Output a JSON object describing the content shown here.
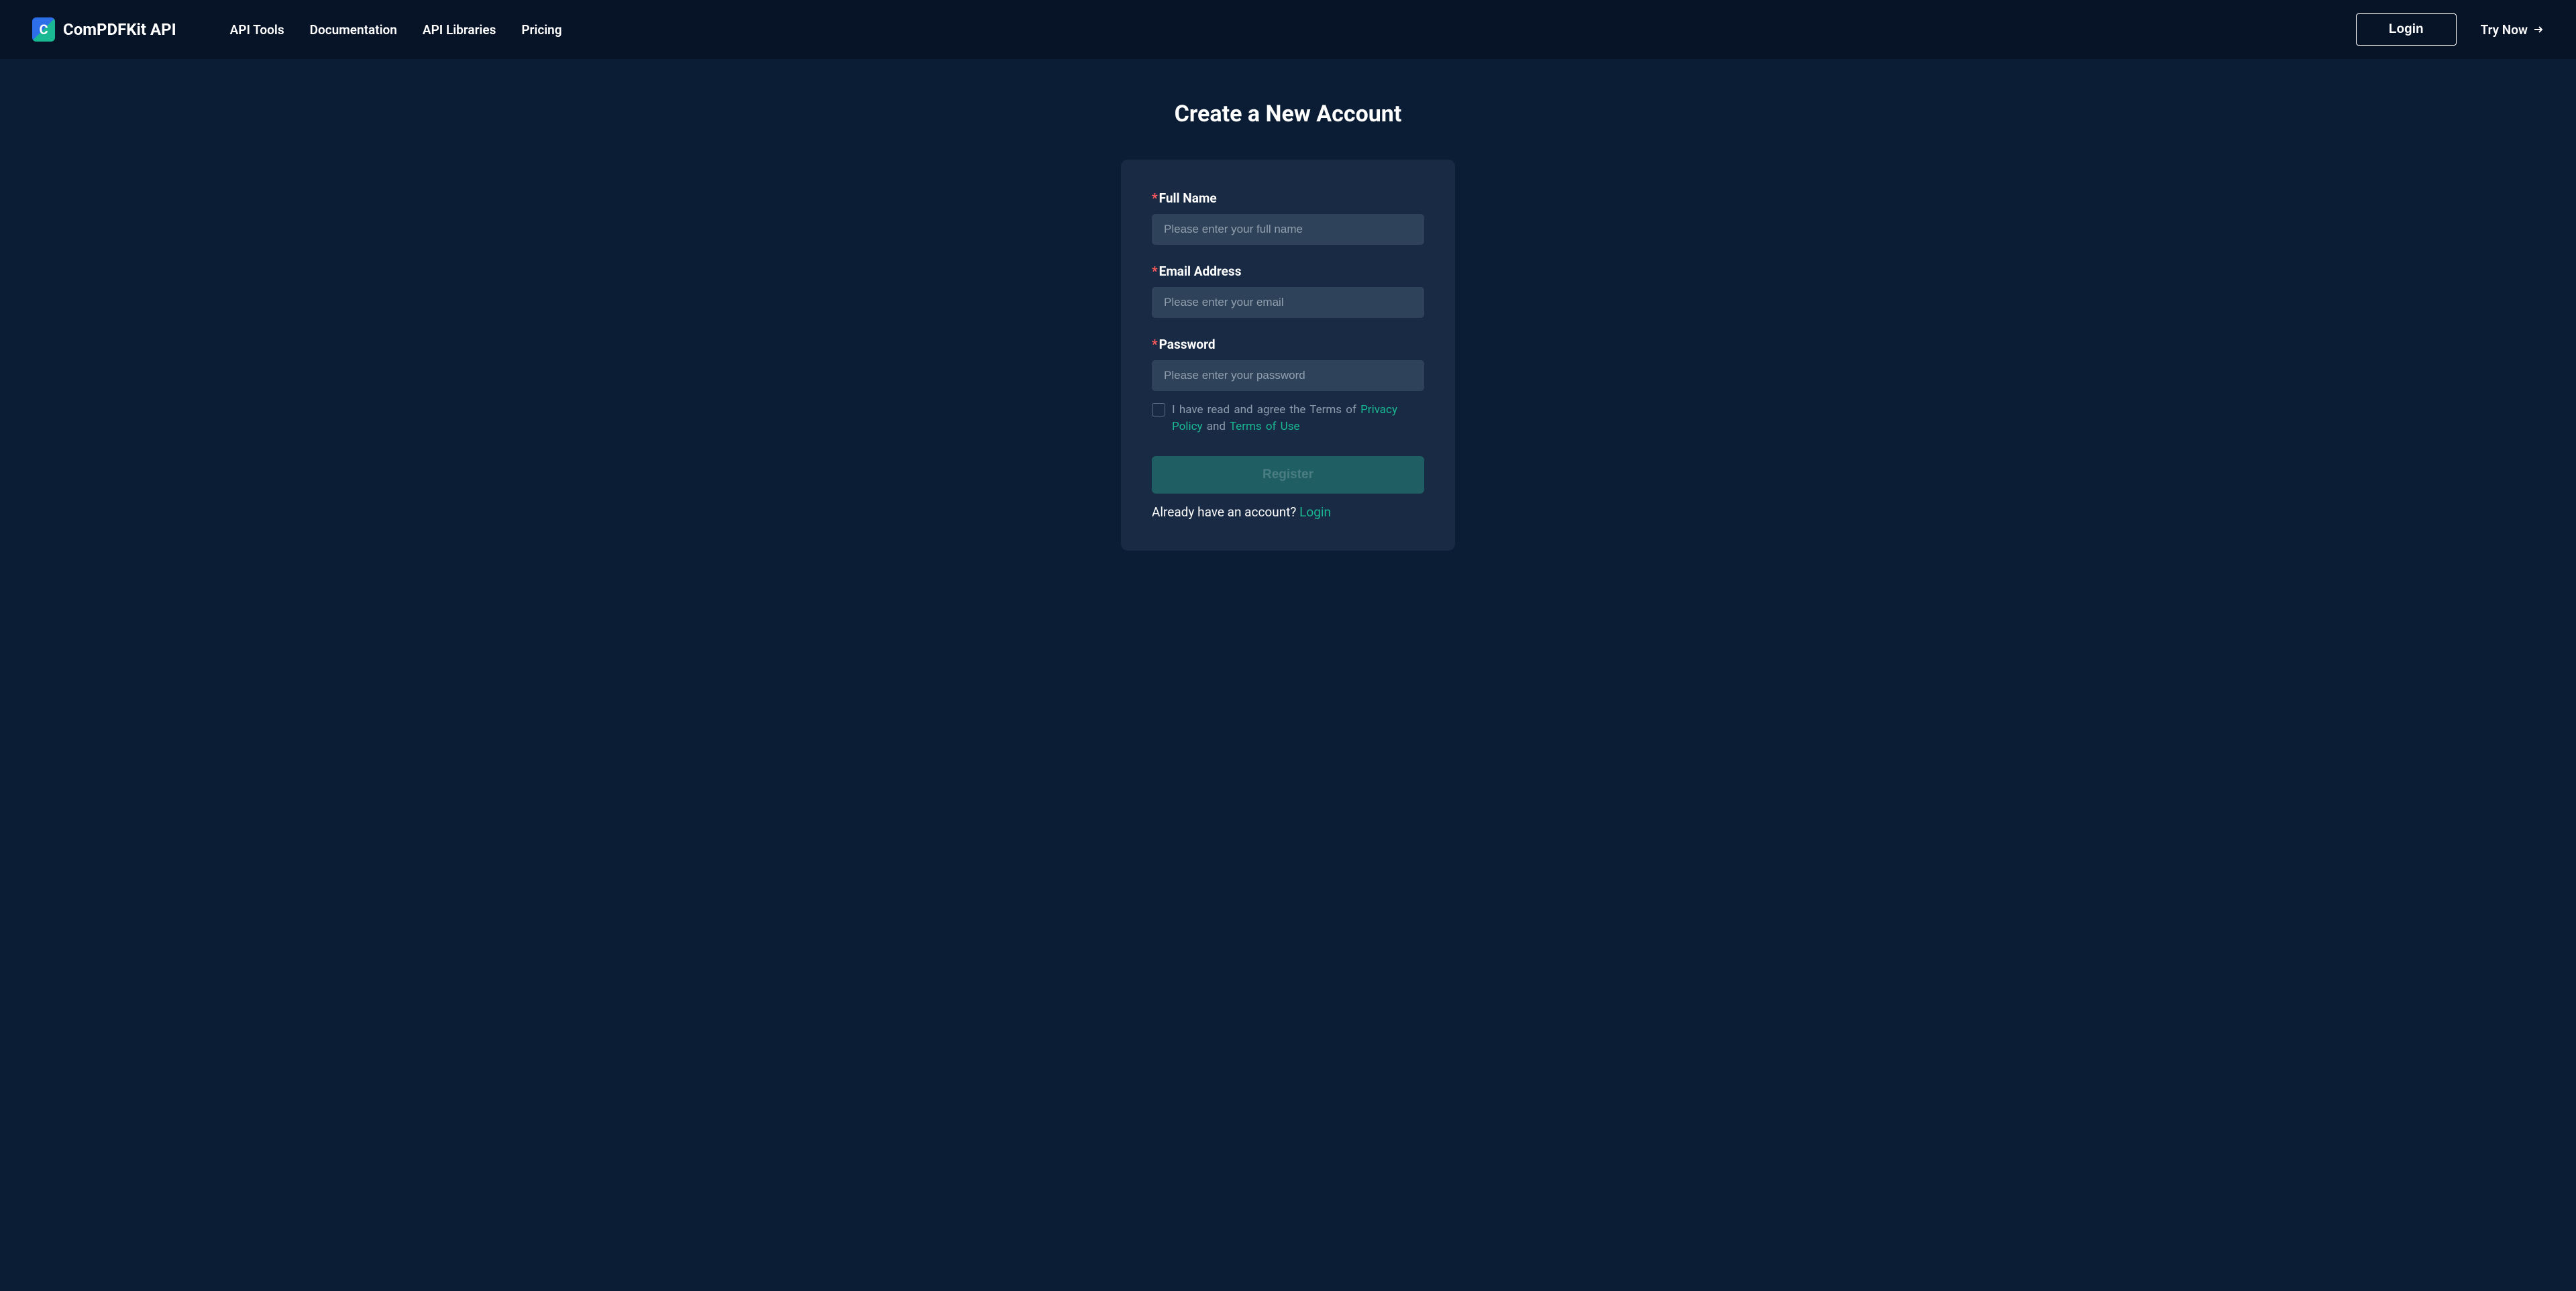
{
  "header": {
    "brand": "ComPDFKit API",
    "nav": {
      "api_tools": "API Tools",
      "documentation": "Documentation",
      "api_libraries": "API Libraries",
      "pricing": "Pricing"
    },
    "login_button": "Login",
    "try_now": "Try Now"
  },
  "page": {
    "title": "Create a New Account"
  },
  "form": {
    "full_name": {
      "label": "Full Name",
      "placeholder": "Please enter your full name",
      "value": ""
    },
    "email": {
      "label": "Email Address",
      "placeholder": "Please enter your email",
      "value": ""
    },
    "password": {
      "label": "Password",
      "placeholder": "Please enter your password",
      "value": ""
    },
    "terms": {
      "prefix": "I have read and agree the Terms of ",
      "privacy_policy": "Privacy Policy",
      "and": " and ",
      "terms_of_use": "Terms of Use"
    },
    "register_button": "Register",
    "already_prefix": "Already have an account? ",
    "login_link": "Login"
  }
}
